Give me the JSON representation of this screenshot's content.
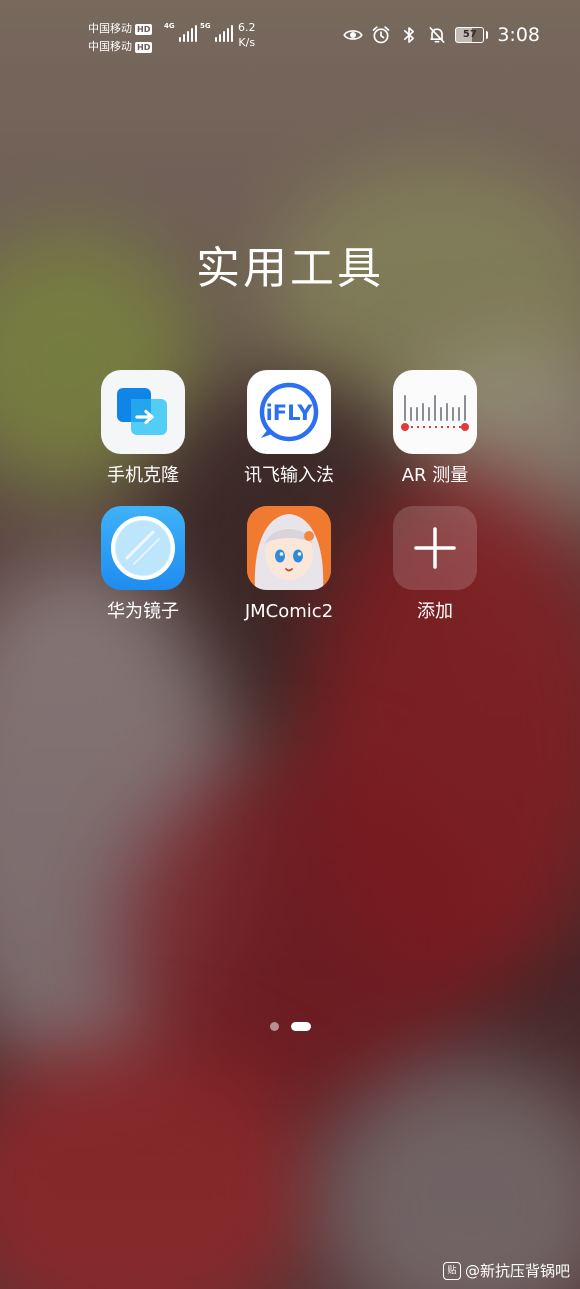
{
  "status_bar": {
    "carrier_1": "中国移动",
    "carrier_2": "中国移动",
    "hd_badge": "HD",
    "net_1": "4G",
    "net_2": "5G",
    "speed_value": "6.2",
    "speed_unit": "K/s",
    "battery_level": "57",
    "time": "3:08",
    "icons": [
      "eye-icon",
      "alarm-icon",
      "bluetooth-icon",
      "mute-icon"
    ]
  },
  "folder": {
    "title": "实用工具",
    "apps": [
      {
        "label": "手机克隆",
        "icon": "phone-clone-icon"
      },
      {
        "label": "讯飞输入法",
        "icon": "ifly-icon"
      },
      {
        "label": "AR 测量",
        "icon": "ar-measure-icon"
      },
      {
        "label": "华为镜子",
        "icon": "mirror-icon"
      },
      {
        "label": "JMComic2",
        "icon": "jmcomic-icon"
      },
      {
        "label": "添加",
        "icon": "add-icon"
      }
    ],
    "ifly_logo_text": "iFLY"
  },
  "page_indicator": {
    "pages": 2,
    "active": 2
  },
  "watermark": {
    "text": "@新抗压背锅吧",
    "logo_text": "贴"
  }
}
